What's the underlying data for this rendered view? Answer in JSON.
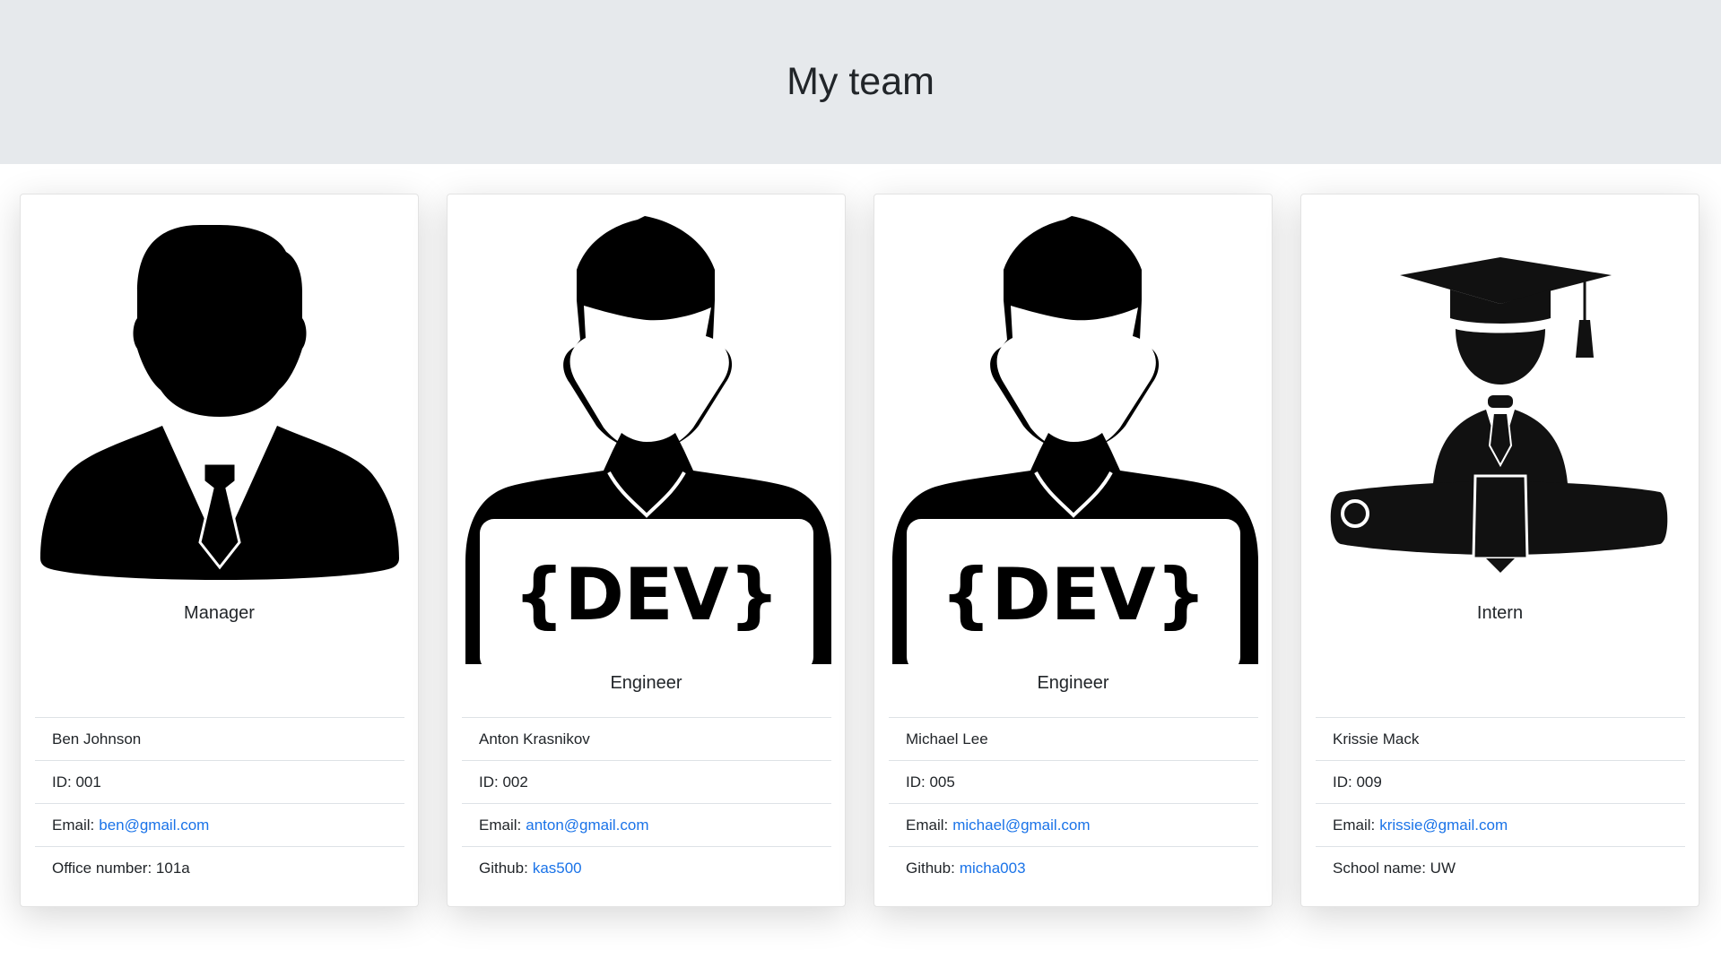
{
  "header": {
    "title": "My team"
  },
  "team": [
    {
      "role": "Manager",
      "icon": "manager-silhouette-icon",
      "name": "Ben Johnson",
      "id_label": "ID: 001",
      "email_prefix": "Email:",
      "email": "ben@gmail.com",
      "extra_label": "Office number: 101a"
    },
    {
      "role": "Engineer",
      "icon": "developer-silhouette-icon",
      "name": "Anton Krasnikov",
      "id_label": "ID: 002",
      "email_prefix": "Email:",
      "email": "anton@gmail.com",
      "github_prefix": "Github:",
      "github": "kas500",
      "dev_sign": "{DEV}"
    },
    {
      "role": "Engineer",
      "icon": "developer-silhouette-icon",
      "name": "Michael Lee",
      "id_label": "ID: 005",
      "email_prefix": "Email:",
      "email": "michael@gmail.com",
      "github_prefix": "Github:",
      "github": "micha003",
      "dev_sign": "{DEV}"
    },
    {
      "role": "Intern",
      "icon": "graduate-silhouette-icon",
      "name": "Krissie Mack",
      "id_label": "ID: 009",
      "email_prefix": "Email:",
      "email": "krissie@gmail.com",
      "extra_label": "School name: UW"
    }
  ],
  "colors": {
    "header_bg": "#e6e9ec",
    "link": "#1a73e8",
    "text": "#212529",
    "divider": "#dee2e6"
  }
}
